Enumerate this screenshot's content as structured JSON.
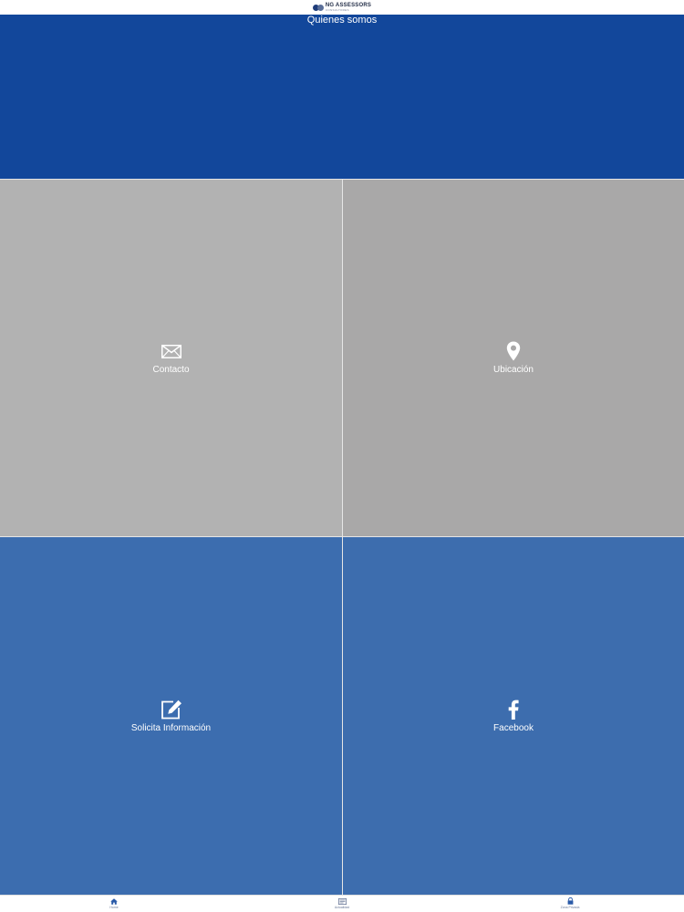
{
  "header": {
    "logo_name": "NG ASSESSORS",
    "logo_sub": "CONSULTORES"
  },
  "hero": {
    "title": "Quienes somos",
    "color": "#12479b"
  },
  "tiles": [
    {
      "label": "Contacto",
      "icon": "envelope-icon",
      "color": "#b2b2b2"
    },
    {
      "label": "Ubicación",
      "icon": "map-pin-icon",
      "color": "#a9a8a8"
    },
    {
      "label": "Solicita Información",
      "icon": "edit-icon",
      "color": "#3c6daf"
    },
    {
      "label": "Facebook",
      "icon": "facebook-icon",
      "color": "#3d6dae"
    }
  ],
  "tabbar": {
    "items": [
      {
        "label": "Home",
        "icon": "home-icon"
      },
      {
        "label": "Actualidad",
        "icon": "news-icon"
      },
      {
        "label": "Zona Privada",
        "icon": "lock-icon"
      }
    ],
    "accent": "#2a5aa8"
  }
}
